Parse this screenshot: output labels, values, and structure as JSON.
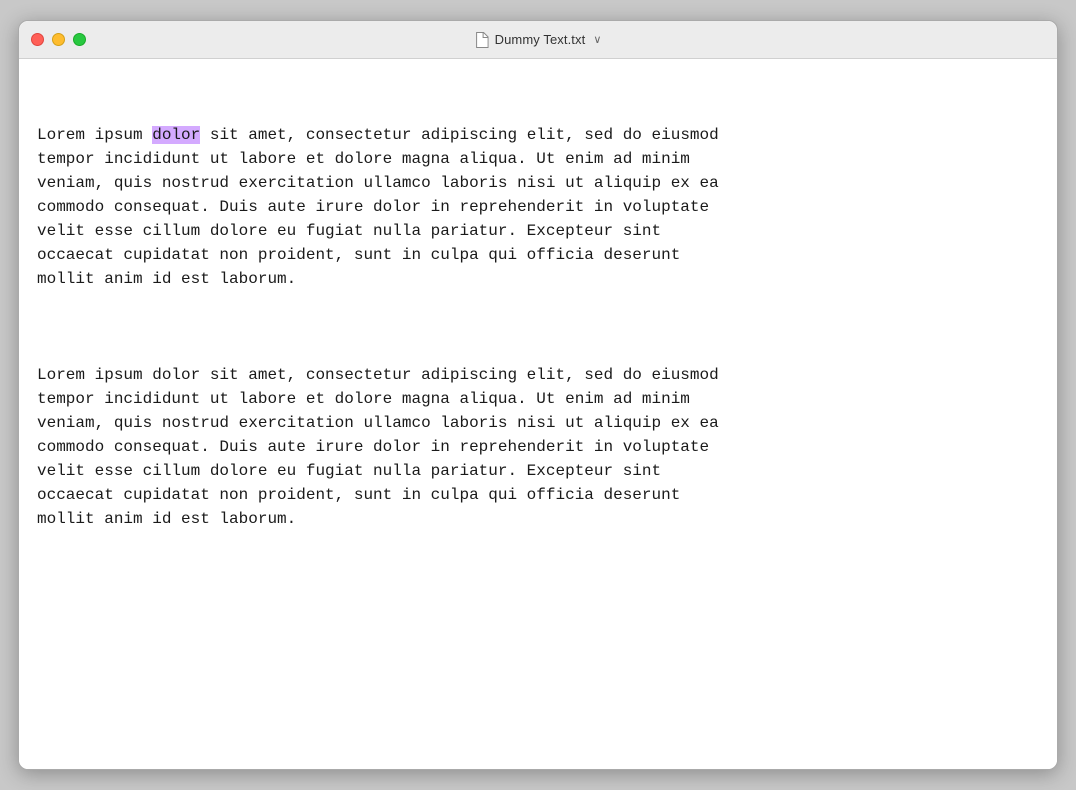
{
  "window": {
    "title": "Dummy Text.txt",
    "title_chevron": "∨"
  },
  "traffic_lights": {
    "close_label": "close",
    "minimize_label": "minimize",
    "maximize_label": "maximize"
  },
  "content": {
    "paragraph1_before_highlight": "Lorem ipsum ",
    "paragraph1_highlight": "dolor",
    "paragraph1_after_highlight": " sit amet, consectetur adipiscing elit, sed do eiusmod\ntempor incididunt ut labore et dolore magna aliqua. Ut enim ad minim\nveniam, quis nostrud exercitation ullamco laboris nisi ut aliquip ex ea\ncommodo consequat. Duis aute irure dolor in reprehenderit in voluptate\nvelit esse cillum dolore eu fugiat nulla pariatur. Excepteur sint\noccaecat cupidatat non proident, sunt in culpa qui officia deserunt\nmollit anim id est laborum.",
    "paragraph2": "Lorem ipsum dolor sit amet, consectetur adipiscing elit, sed do eiusmod\ntempor incididunt ut labore et dolore magna aliqua. Ut enim ad minim\nveniam, quis nostrud exercitation ullamco laboris nisi ut aliquip ex ea\ncommodo consequat. Duis aute irure dolor in reprehenderit in voluptate\nvelit esse cillum dolore eu fugiat nulla pariatur. Excepteur sint\noccaecat cupidatat non proident, sunt in culpa qui officia deserunt\nmollit anim id est laborum."
  }
}
